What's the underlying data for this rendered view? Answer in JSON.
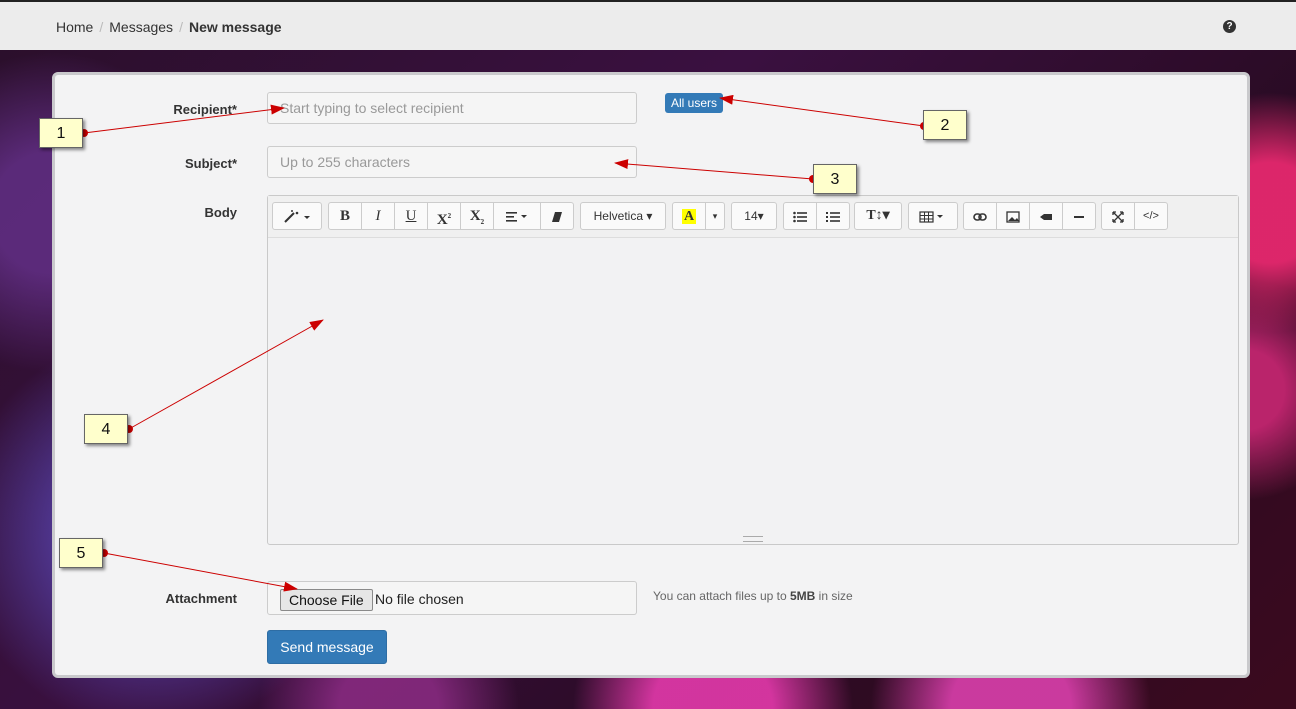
{
  "breadcrumb": {
    "home": "Home",
    "messages": "Messages",
    "current": "New message"
  },
  "help_icon": {
    "glyph": "?"
  },
  "form": {
    "recipient_label": "Recipient*",
    "recipient_placeholder": "Start typing to select recipient",
    "all_users_badge": "All users",
    "subject_label": "Subject*",
    "subject_placeholder": "Up to 255 characters",
    "body_label": "Body",
    "attachment_label": "Attachment",
    "choose_file": "Choose File",
    "no_file": "No file chosen",
    "attach_help_prefix": "You can attach files up to ",
    "attach_help_size": "5MB",
    "attach_help_suffix": " in size",
    "send_button": "Send message"
  },
  "toolbar": {
    "font_name": "Helvetica",
    "font_size": "14",
    "icons": [
      "magic-wand-icon",
      "bold-icon",
      "italic-icon",
      "underline-icon",
      "superscript-icon",
      "subscript-icon",
      "align-icon",
      "eraser-icon",
      "font-select",
      "text-color-icon",
      "font-size-select",
      "unordered-list-icon",
      "ordered-list-icon",
      "line-height-icon",
      "table-icon",
      "link-icon",
      "image-icon",
      "video-icon",
      "horizontal-rule-icon",
      "fullscreen-icon",
      "code-view-icon"
    ]
  },
  "callouts": [
    "1",
    "2",
    "3",
    "4",
    "5"
  ],
  "colors": {
    "primary": "#337ab7",
    "callout_bg": "#ffffcc",
    "arrow": "#cc0000"
  }
}
